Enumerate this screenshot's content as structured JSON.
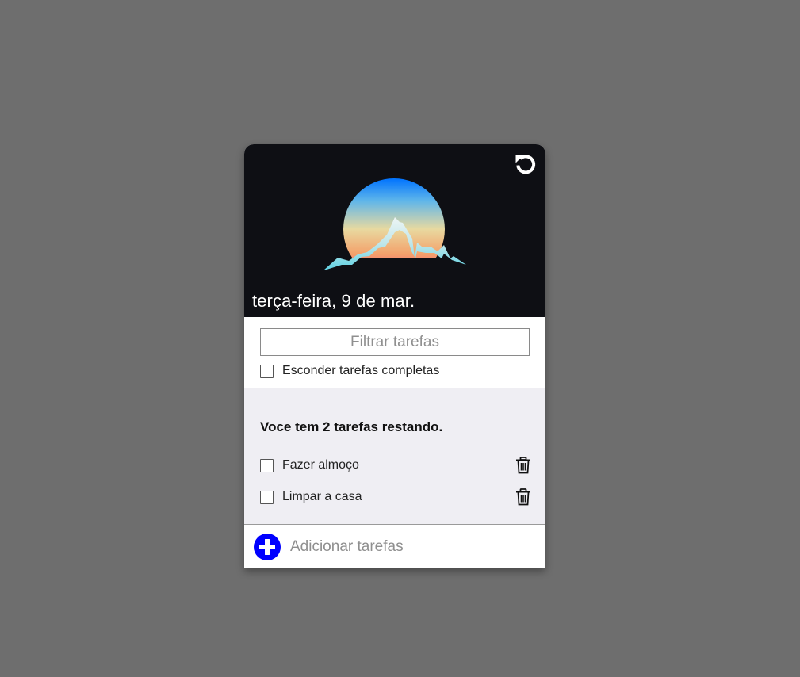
{
  "header": {
    "date": "terça-feira, 9 de mar.",
    "reset_icon": "reset-icon",
    "logo_icon": "mountain-sun-logo"
  },
  "filters": {
    "search_placeholder": "Filtrar tarefas",
    "search_value": "",
    "hide_completed_label": "Esconder tarefas completas",
    "hide_completed_checked": false
  },
  "tasks": {
    "remaining_text": "Voce tem 2 tarefas restando.",
    "items": [
      {
        "label": "Fazer almoço",
        "checked": false
      },
      {
        "label": "Limpar a casa",
        "checked": false
      }
    ]
  },
  "add": {
    "placeholder": "Adicionar tarefas",
    "value": "",
    "button_icon": "plus-circle-icon"
  },
  "colors": {
    "background": "#6e6e6e",
    "header_bg": "#0e0f14",
    "tasks_bg": "#efeef3",
    "add_button": "#0000ff"
  }
}
